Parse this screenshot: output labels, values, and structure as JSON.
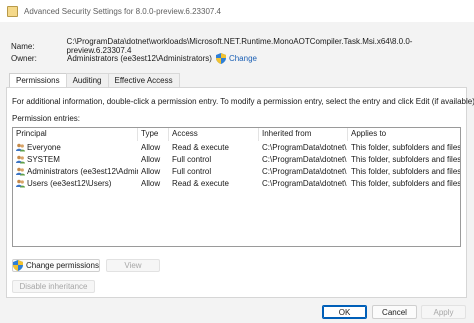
{
  "window": {
    "title": "Advanced Security Settings for 8.0.0-preview.6.23307.4"
  },
  "info": {
    "name_label": "Name:",
    "name_value": "C:\\ProgramData\\dotnet\\workloads\\Microsoft.NET.Runtime.MonoAOTCompiler.Task.Msi.x64\\8.0.0-preview.6.23307.4",
    "owner_label": "Owner:",
    "owner_value": "Administrators (ee3est12\\Administrators)",
    "change_link": "Change"
  },
  "tabs": [
    {
      "label": "Permissions",
      "active": true
    },
    {
      "label": "Auditing",
      "active": false
    },
    {
      "label": "Effective Access",
      "active": false
    }
  ],
  "permissions": {
    "help_text": "For additional information, double-click a permission entry. To modify a permission entry, select the entry and click Edit (if available).",
    "entries_label": "Permission entries:",
    "columns": [
      "Principal",
      "Type",
      "Access",
      "Inherited from",
      "Applies to"
    ],
    "rows": [
      [
        "Everyone",
        "Allow",
        "Read & execute",
        "C:\\ProgramData\\dotnet\\",
        "This folder, subfolders and files"
      ],
      [
        "SYSTEM",
        "Allow",
        "Full control",
        "C:\\ProgramData\\dotnet\\",
        "This folder, subfolders and files"
      ],
      [
        "Administrators (ee3est12\\Admini...",
        "Allow",
        "Full control",
        "C:\\ProgramData\\dotnet\\",
        "This folder, subfolders and files"
      ],
      [
        "Users (ee3est12\\Users)",
        "Allow",
        "Read & execute",
        "C:\\ProgramData\\dotnet\\",
        "This folder, subfolders and files"
      ]
    ],
    "change_permissions_button": "Change permissions",
    "view_button": "View",
    "disable_inheritance_button": "Disable inheritance"
  },
  "footer": {
    "ok": "OK",
    "cancel": "Cancel",
    "apply": "Apply"
  },
  "colors": {
    "accent": "#005fb8",
    "link": "#1a5fb4"
  }
}
